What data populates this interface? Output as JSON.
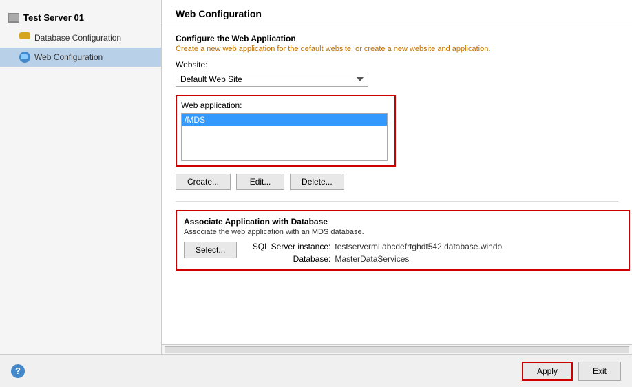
{
  "sidebar": {
    "server_label": "Test Server 01",
    "items": [
      {
        "id": "database-config",
        "label": "Database Configuration",
        "icon": "db-icon",
        "active": false
      },
      {
        "id": "web-config",
        "label": "Web Configuration",
        "icon": "web-icon",
        "active": true
      }
    ]
  },
  "content": {
    "title": "Web Configuration",
    "configure_section": {
      "title": "Configure the Web Application",
      "desc": "Create a new web application for the default website, or create a new website and application."
    },
    "website_label": "Website:",
    "website_value": "Default Web Site",
    "webapp_label": "Web application:",
    "webapp_item": "/MDS",
    "buttons": {
      "create": "Create...",
      "edit": "Edit...",
      "delete": "Delete..."
    },
    "associate_section": {
      "title": "Associate Application with Database",
      "desc": "Associate the web application with an MDS database.",
      "select_btn": "Select...",
      "sql_server_label": "SQL Server instance:",
      "sql_server_value": "testservermi.abcdefrtghdt542.database.windo",
      "database_label": "Database:",
      "database_value": "MasterDataServices"
    }
  },
  "bottom": {
    "apply_label": "Apply",
    "exit_label": "Exit"
  }
}
